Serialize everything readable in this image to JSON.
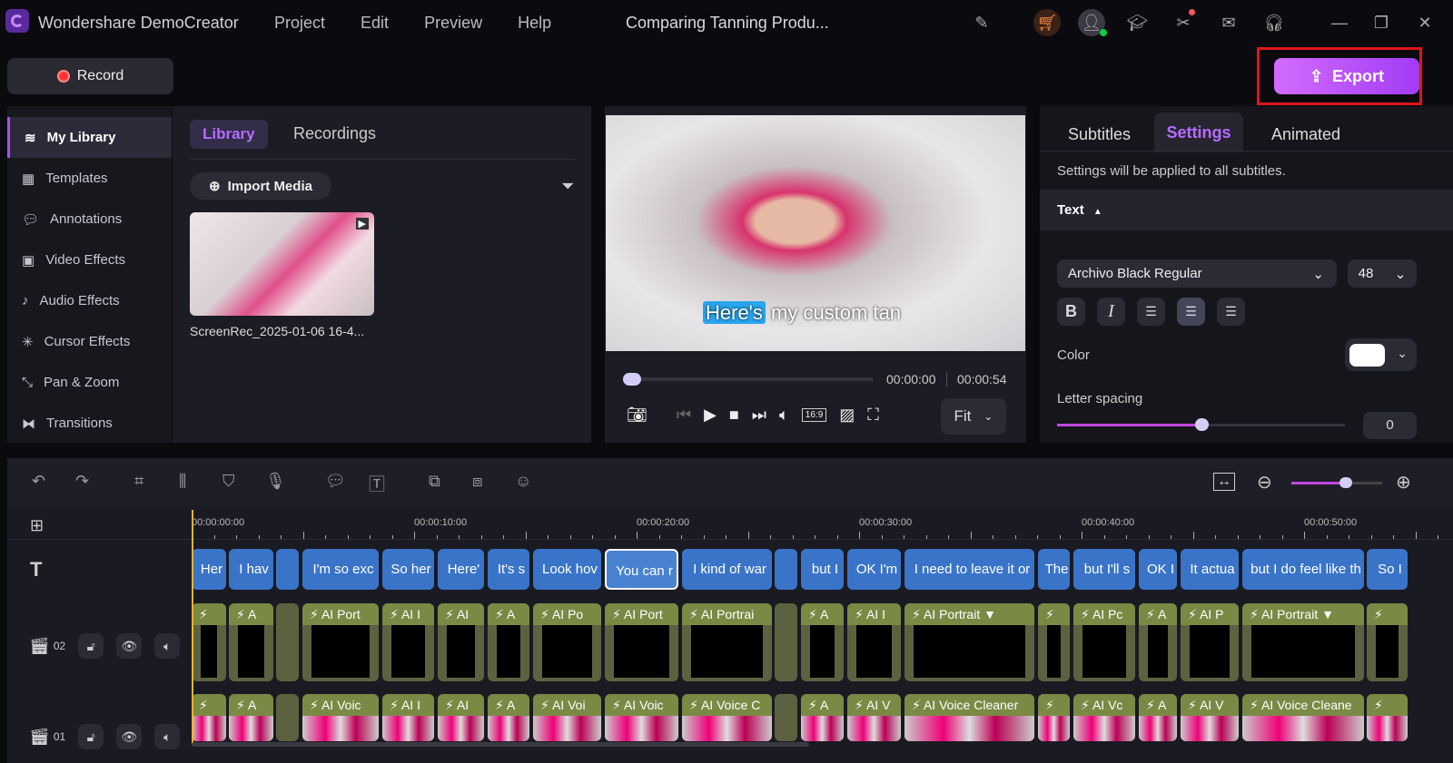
{
  "app": {
    "title": "Wondershare DemoCreator",
    "project_title": "Comparing Tanning Produ...",
    "menu": [
      "Project",
      "Edit",
      "Preview",
      "Help"
    ]
  },
  "toolbar_icons": [
    "feedback-icon",
    "cart-icon",
    "account-icon",
    "tutorial-icon",
    "tools-icon",
    "mail-icon",
    "support-icon",
    "minimize-icon",
    "restore-icon",
    "close-icon"
  ],
  "record": {
    "label": "Record"
  },
  "export": {
    "label": "Export"
  },
  "sidebar": {
    "items": [
      {
        "label": "My Library",
        "icon": "layers-icon"
      },
      {
        "label": "Templates",
        "icon": "templates-icon"
      },
      {
        "label": "Annotations",
        "icon": "annotation-icon"
      },
      {
        "label": "Video Effects",
        "icon": "video-effects-icon"
      },
      {
        "label": "Audio Effects",
        "icon": "audio-effects-icon"
      },
      {
        "label": "Cursor Effects",
        "icon": "cursor-icon"
      },
      {
        "label": "Pan & Zoom",
        "icon": "pan-zoom-icon"
      },
      {
        "label": "Transitions",
        "icon": "transitions-icon"
      }
    ]
  },
  "library": {
    "tabs": [
      "Library",
      "Recordings"
    ],
    "import_label": "Import Media",
    "media": [
      {
        "name": "ScreenRec_2025-01-06 16-4..."
      }
    ]
  },
  "preview": {
    "subtitle_highlight": "Here's",
    "subtitle_rest": " my custom tan",
    "current_time": "00:00:00",
    "total_time": "00:00:54",
    "fit": "Fit",
    "progress": 0
  },
  "settings": {
    "tabs": [
      "Subtitles",
      "Settings",
      "Animated"
    ],
    "note": "Settings will be applied to all subtitles.",
    "section": "Text",
    "font": "Archivo Black Regular",
    "size": "48",
    "color_label": "Color",
    "color_value": "#ffffff",
    "spacing_label": "Letter spacing",
    "spacing_value": "0",
    "spacing_level": 0.5
  },
  "timeline": {
    "ruler": [
      "00:00:00:00",
      "00:00:10:00",
      "00:00:20:00",
      "00:00:30:00",
      "00:00:40:00",
      "00:00:50:00"
    ],
    "tracks": [
      {
        "num": "02"
      },
      {
        "num": "01"
      }
    ],
    "zoom_level": 0.6,
    "subtitles": [
      "Her",
      "I hav",
      "",
      "I'm so exc",
      "So her",
      "Here'",
      "It's s",
      "Look hov",
      "You can r",
      "I kind of war",
      "",
      "but I",
      "OK I'm",
      "I need to leave it or",
      "The",
      "but I'll s",
      "OK I",
      "It actua",
      "but I do feel like th",
      "So I"
    ],
    "video_clips": [
      "",
      "A",
      "",
      "AI Port",
      "AI I",
      "AI",
      "A",
      "AI Po",
      "AI Port",
      "AI Portrai",
      "",
      "A",
      "AI I",
      "AI Portrait ▼",
      "",
      "AI Pc",
      "A",
      "AI P",
      "AI Portrait ▼",
      ""
    ],
    "audio_clips": [
      "",
      "A",
      "",
      "AI Voic",
      "AI I",
      "AI",
      "A",
      "AI Voi",
      "AI Voic",
      "AI Voice C",
      "",
      "A",
      "AI V",
      "AI Voice Cleaner",
      "",
      "AI Vc",
      "A",
      "AI V",
      "AI Voice Cleane",
      ""
    ]
  }
}
